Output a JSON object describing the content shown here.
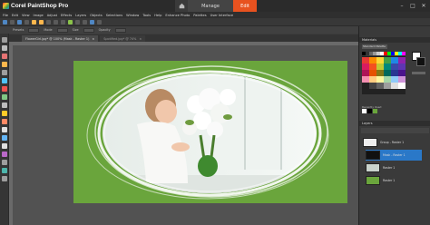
{
  "app": {
    "logo_name": "Corel PaintShop Pro",
    "version": "2020"
  },
  "workspace_tabs": {
    "manage": "Manage",
    "edit": "Edit"
  },
  "window_controls": {
    "minimize": "–",
    "maximize": "□",
    "close": "✕"
  },
  "menu": [
    "File",
    "Edit",
    "View",
    "Image",
    "Adjust",
    "Effects",
    "Layers",
    "Objects",
    "Selections",
    "Window",
    "Tools",
    "Help",
    "Enhance Photo",
    "Palettes",
    "User Interface"
  ],
  "tool_options": {
    "presets": "Presets",
    "mode": "Mode",
    "size": "Size",
    "opacity": "Opacity"
  },
  "document_tabs": [
    {
      "label": "FlowerGirl.jpg* @ 100% (Mask - Raster 1)",
      "close": "×"
    },
    {
      "label": "Spotified.jpg* @ 74%",
      "close": "×"
    }
  ],
  "panels": {
    "materials": "Materials",
    "material_dropdown": "Standard Palette",
    "recently_used": "Recently Used",
    "layers": "Layers"
  },
  "layers": [
    {
      "name": "Group - Raster 1"
    },
    {
      "name": "Mask - Raster 1"
    },
    {
      "name": "Raster 1"
    },
    {
      "name": "Raster 1"
    }
  ],
  "colors": {
    "accent": "#e8521f",
    "selection": "#2a78c8",
    "background_green": "#6aa53c"
  }
}
